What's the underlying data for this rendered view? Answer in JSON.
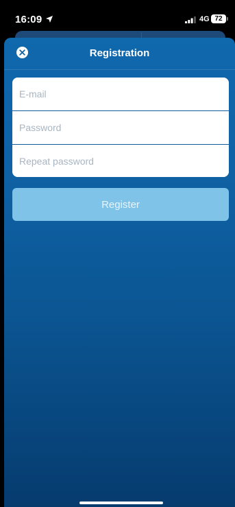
{
  "status_bar": {
    "time": "16:09",
    "network": "4G",
    "battery": "72"
  },
  "nav": {
    "title": "Registration"
  },
  "form": {
    "email_placeholder": "E-mail",
    "password_placeholder": "Password",
    "repeat_password_placeholder": "Repeat password",
    "email_value": "",
    "password_value": "",
    "repeat_password_value": ""
  },
  "actions": {
    "register_label": "Register"
  },
  "colors": {
    "sheet_top": "#1068ad",
    "sheet_bottom": "#063b6e",
    "button_disabled": "#7fc4e8"
  },
  "icons": {
    "close": "close-icon",
    "location": "location-arrow-icon",
    "signal": "signal-bars-icon"
  }
}
